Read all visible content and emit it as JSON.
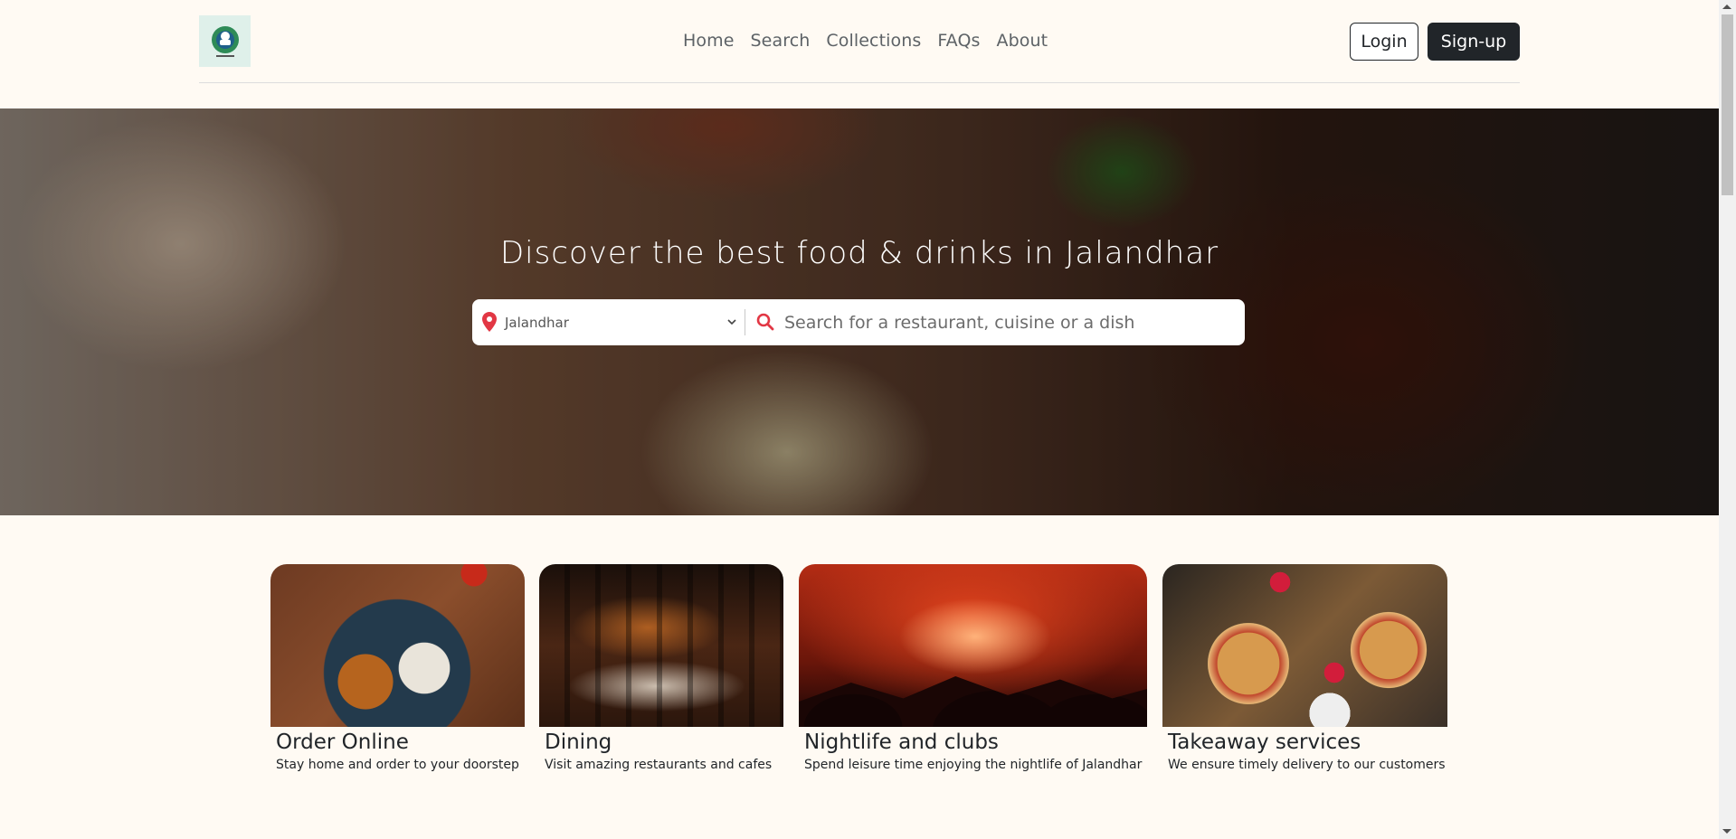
{
  "header": {
    "logo_icon": "orderbuffe-logo-icon",
    "nav": [
      "Home",
      "Search",
      "Collections",
      "FAQs",
      "About"
    ],
    "login_label": "Login",
    "signup_label": "Sign-up"
  },
  "hero": {
    "title": "Discover the best food & drinks in Jalandhar",
    "location_value": "Jalandhar",
    "search_placeholder": "Search for a restaurant, cuisine or a dish"
  },
  "cards": [
    {
      "title": "Order Online",
      "desc": "Stay home and order to your doorstep"
    },
    {
      "title": "Dining",
      "desc": "Visit amazing restaurants and cafes"
    },
    {
      "title": "Nightlife and clubs",
      "desc": "Spend leisure time enjoying the nightlife of Jalandhar"
    },
    {
      "title": "Takeaway services",
      "desc": "We ensure timely delivery to our customers"
    }
  ],
  "colors": {
    "background": "#fffaf3",
    "dark_button": "#212529",
    "accent_red": "#e23744"
  }
}
